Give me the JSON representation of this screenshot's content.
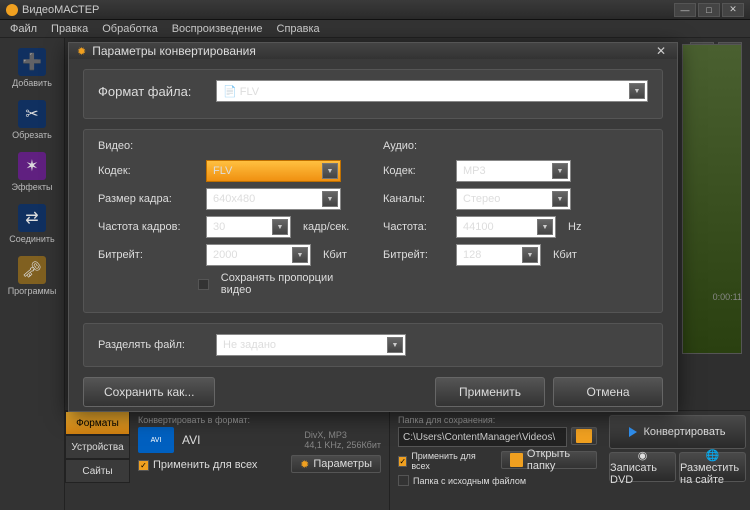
{
  "app": {
    "title": "ВидеоМАСТЕР"
  },
  "menu": [
    "Файл",
    "Правка",
    "Обработка",
    "Воспроизведение",
    "Справка"
  ],
  "sidebar": [
    {
      "label": "Добавить",
      "icon": "➕",
      "bg": "#103060"
    },
    {
      "label": "Обрезать",
      "icon": "✂",
      "bg": "#103060"
    },
    {
      "label": "Эффекты",
      "icon": "✶",
      "bg": "#602080"
    },
    {
      "label": "Соединить",
      "icon": "⇄",
      "bg": "#103060"
    },
    {
      "label": "Программы",
      "icon": "🗝",
      "bg": "#806020"
    }
  ],
  "toolbar_right": [
    "GIF",
    "⛶"
  ],
  "time": "0:00:11",
  "tabs": {
    "formats": "Форматы",
    "devices": "Устройства",
    "sites": "Сайты"
  },
  "fmt": {
    "head": "Конвертировать в формат:",
    "name": "AVI",
    "det": "DivX, MP3\n44,1 KHz, 256Кбит",
    "apply_all": "Применить для всех",
    "params": "Параметры"
  },
  "dest": {
    "head": "Папка для сохранения:",
    "path": "C:\\Users\\ContentManager\\Videos\\",
    "apply_all": "Применить для всех",
    "src_folder": "Папка с исходным файлом",
    "open": "Открыть папку"
  },
  "actions": {
    "convert": "Конвертировать",
    "dvd": "Записать DVD",
    "upload": "Разместить на сайте"
  },
  "modal": {
    "title": "Параметры конвертирования",
    "format_label": "Формат файла:",
    "format_val": "FLV",
    "video_h": "Видео:",
    "audio_h": "Аудио:",
    "v_codec_l": "Кодек:",
    "v_codec": "FLV",
    "v_size_l": "Размер кадра:",
    "v_size": "640x480",
    "v_fps_l": "Частота кадров:",
    "v_fps": "30",
    "v_fps_u": "кадр/сек.",
    "v_br_l": "Битрейт:",
    "v_br": "2000",
    "v_br_u": "Кбит",
    "keep_ratio": "Сохранять пропорции видео",
    "a_codec_l": "Кодек:",
    "a_codec": "MP3",
    "a_ch_l": "Каналы:",
    "a_ch": "Стерео",
    "a_hz_l": "Частота:",
    "a_hz": "44100",
    "a_hz_u": "Hz",
    "a_br_l": "Битрейт:",
    "a_br": "128",
    "a_br_u": "Кбит",
    "split_l": "Разделять файл:",
    "split": "Не задано",
    "saveas": "Сохранить как...",
    "apply": "Применить",
    "cancel": "Отмена"
  }
}
